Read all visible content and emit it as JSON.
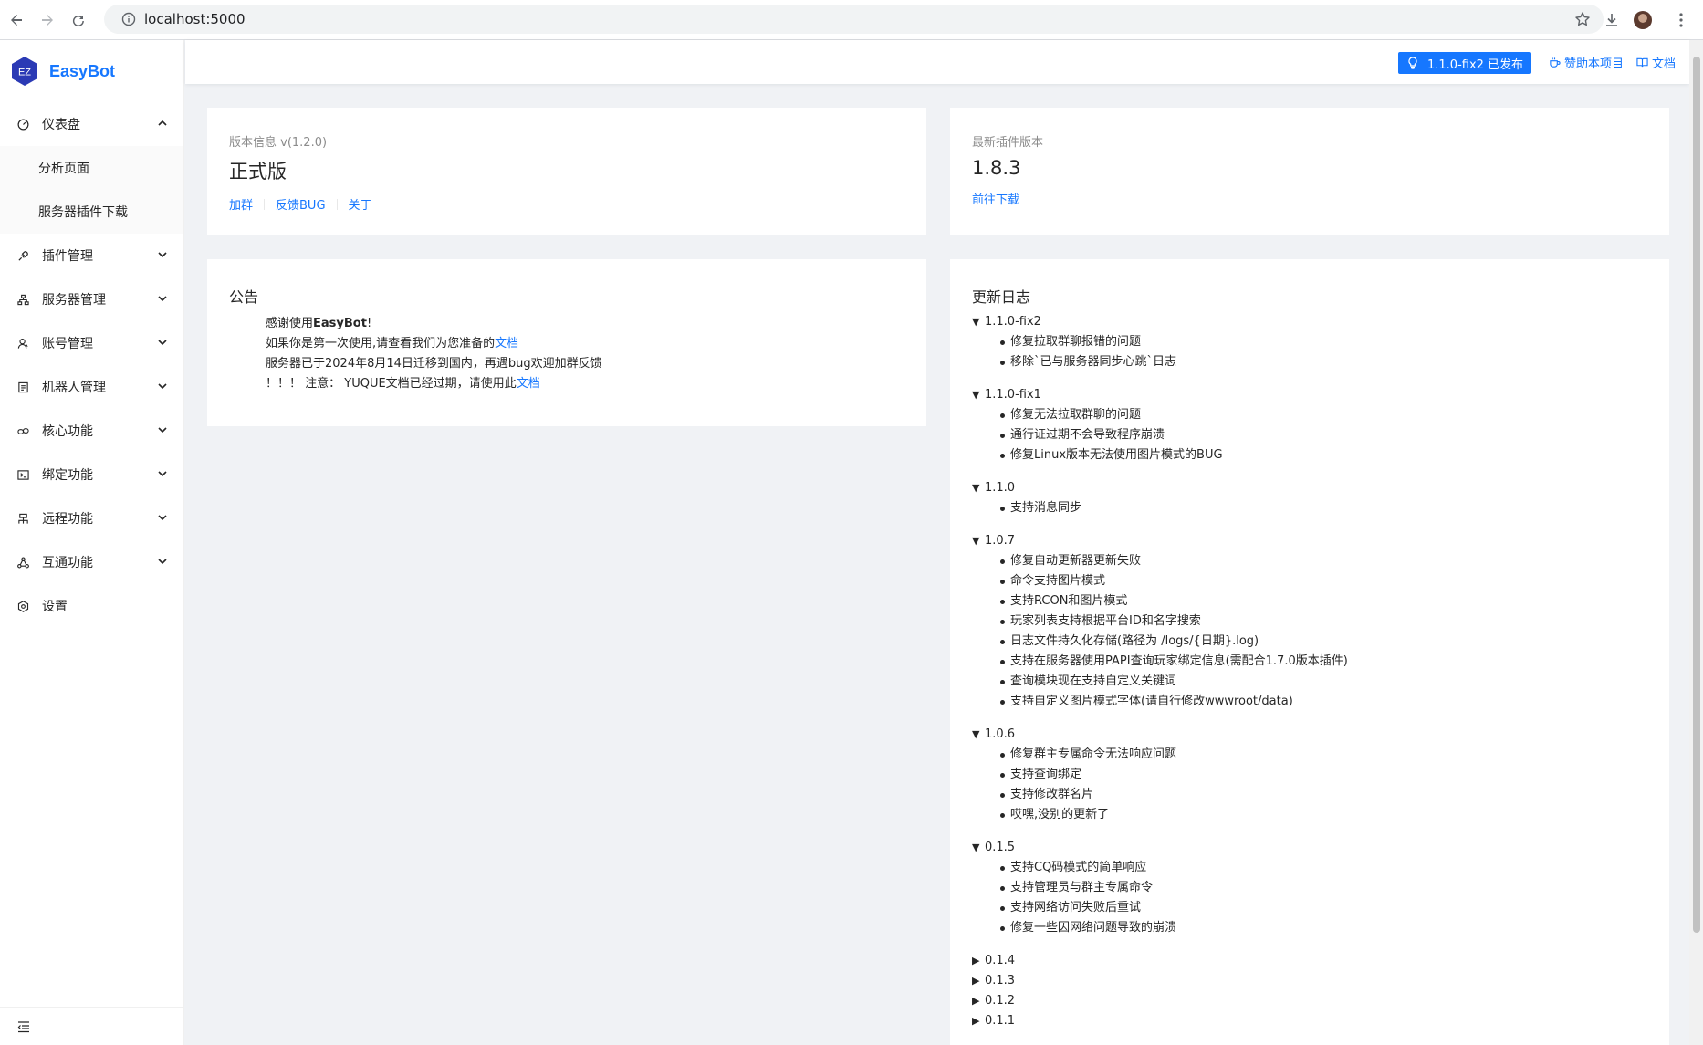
{
  "browser": {
    "url": "localhost:5000"
  },
  "brand": {
    "logo_text": "EZ",
    "name": "EasyBot"
  },
  "sidebar": {
    "items": [
      {
        "label": "仪表盘",
        "icon": "dashboard-icon",
        "expanded": true
      },
      {
        "label": "插件管理",
        "icon": "plugin-icon"
      },
      {
        "label": "服务器管理",
        "icon": "server-icon"
      },
      {
        "label": "账号管理",
        "icon": "user-icon"
      },
      {
        "label": "机器人管理",
        "icon": "robot-icon"
      },
      {
        "label": "核心功能",
        "icon": "core-icon"
      },
      {
        "label": "绑定功能",
        "icon": "bind-icon"
      },
      {
        "label": "远程功能",
        "icon": "remote-icon"
      },
      {
        "label": "互通功能",
        "icon": "share-icon"
      },
      {
        "label": "设置",
        "icon": "settings-icon"
      }
    ],
    "dashboard_subitems": [
      "分析页面",
      "服务器插件下载"
    ]
  },
  "header": {
    "release_tag": "1.1.0-fix2 已发布",
    "sponsor_label": "赞助本项目",
    "docs_label": "文档"
  },
  "version_card": {
    "label": "版本信息 v(1.2.0)",
    "value": "正式版",
    "links": [
      "加群",
      "反馈BUG",
      "关于"
    ]
  },
  "plugin_card": {
    "label": "最新插件版本",
    "value": "1.8.3",
    "link": "前往下载"
  },
  "notice_card": {
    "title": "公告",
    "line1_prefix": "感谢使用",
    "line1_bold": "EasyBot",
    "line1_suffix": "!",
    "line2_prefix": "如果你是第一次使用,请查看我们为您准备的",
    "line2_link": "文档",
    "line3": "服务器已于2024年8月14日迁移到国内，再遇bug欢迎加群反馈",
    "line4_prefix": "！！！ 注意： YUQUE文档已经过期，请使用此",
    "line4_link": "文档"
  },
  "changelog": {
    "title": "更新日志",
    "versions": [
      {
        "version": "1.1.0-fix2",
        "items": [
          "修复拉取群聊报错的问题",
          "移除`已与服务器同步心跳`日志"
        ]
      },
      {
        "version": "1.1.0-fix1",
        "items": [
          "修复无法拉取群聊的问题",
          "通行证过期不会导致程序崩溃",
          "修复Linux版本无法使用图片模式的BUG"
        ]
      },
      {
        "version": "1.1.0",
        "items": [
          "支持消息同步"
        ]
      },
      {
        "version": "1.0.7",
        "items": [
          "修复自动更新器更新失败",
          "命令支持图片模式",
          "支持RCON和图片模式",
          "玩家列表支持根据平台ID和名字搜索",
          "日志文件持久化存储(路径为 /logs/{日期}.log)",
          "支持在服务器使用PAPI查询玩家绑定信息(需配合1.7.0版本插件)",
          "查询模块现在支持自定义关键词",
          "支持自定义图片模式字体(请自行修改wwwroot/data)"
        ]
      },
      {
        "version": "1.0.6",
        "items": [
          "修复群主专属命令无法响应问题",
          "支持查询绑定",
          "支持修改群名片",
          "哎嘿,没别的更新了"
        ]
      },
      {
        "version": "0.1.5",
        "items": [
          "支持CQ码模式的简单响应",
          "支持管理员与群主专属命令",
          "支持网络访问失败后重试",
          "修复一些因网络问题导致的崩溃"
        ]
      }
    ],
    "collapsed": [
      "0.1.4",
      "0.1.3",
      "0.1.2",
      "0.1.1"
    ]
  },
  "colors": {
    "accent": "#1677ff",
    "background": "#f0f2f5"
  }
}
